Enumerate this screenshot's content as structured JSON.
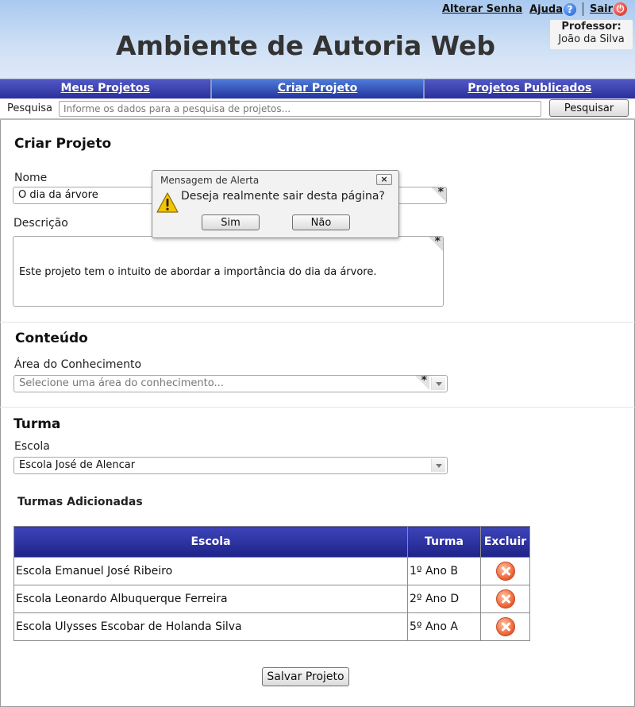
{
  "header": {
    "app_title": "Ambiente de Autoria Web",
    "links": {
      "change_password": "Alterar Senha",
      "help": "Ajuda",
      "logout": "Sair"
    },
    "professor_label": "Professor:",
    "professor_name": "João da Silva"
  },
  "nav": {
    "tabs": [
      {
        "label": "Meus Projetos",
        "active": false
      },
      {
        "label": "Criar Projeto",
        "active": true
      },
      {
        "label": "Projetos Publicados",
        "active": false
      }
    ]
  },
  "search": {
    "label": "Pesquisa",
    "placeholder": "Informe os dados para a pesquisa de projetos...",
    "button": "Pesquisar"
  },
  "form": {
    "title": "Criar Projeto",
    "name_label": "Nome",
    "name_value": "O dia da árvore",
    "description_label": "Descrição",
    "description_value": "Este projeto tem o intuito de abordar a importância do dia da árvore.",
    "required_mark": "*",
    "content_title": "Conteúdo",
    "area_label": "Área do Conhecimento",
    "area_placeholder": "Selecione uma área do conhecimento...",
    "class_title": "Turma",
    "school_label": "Escola",
    "school_value": "Escola José de Alencar",
    "added_classes_title": "Turmas Adicionadas",
    "table": {
      "headers": [
        "Escola",
        "Turma",
        "Excluir"
      ],
      "rows": [
        {
          "school": "Escola Emanuel José Ribeiro",
          "class": "1º Ano B"
        },
        {
          "school": "Escola Leonardo Albuquerque Ferreira",
          "class": "2º Ano D"
        },
        {
          "school": "Escola Ulysses Escobar de Holanda Silva",
          "class": "5º Ano A"
        }
      ]
    },
    "save_button": "Salvar Projeto"
  },
  "dialog": {
    "title": "Mensagem de Alerta",
    "close": "×",
    "message": "Deseja realmente sair desta página?",
    "yes": "Sim",
    "no": "Não"
  },
  "icons": [
    "help-icon",
    "power-icon",
    "delete-icon",
    "warning-icon",
    "close-icon",
    "dropdown-arrow-icon"
  ]
}
